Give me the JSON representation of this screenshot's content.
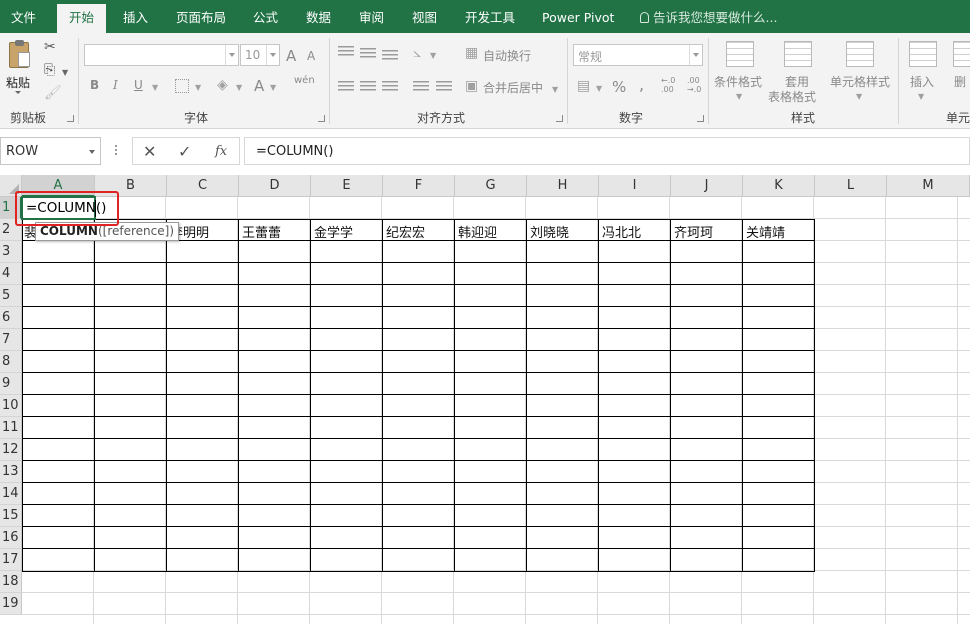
{
  "ribbon_tabs": [
    "文件",
    "开始",
    "插入",
    "页面布局",
    "公式",
    "数据",
    "审阅",
    "视图",
    "开发工具",
    "Power Pivot"
  ],
  "tell_me": "告诉我您想要做什么...",
  "clipboard": {
    "paste": "粘贴",
    "label": "剪贴板"
  },
  "font": {
    "size": "10",
    "label": "字体",
    "bold": "B",
    "italic": "I",
    "underline": "U",
    "grow": "A",
    "shrink": "A",
    "color": "A",
    "phonetic": "wén"
  },
  "alignment": {
    "wrap": "自动换行",
    "merge": "合并后居中",
    "label": "对齐方式"
  },
  "number": {
    "format": "常规",
    "percent": "%",
    "comma": ",",
    "inc": "←.0 .00",
    "dec": ".00 →.0",
    "label": "数字"
  },
  "styles": {
    "cond": "条件格式",
    "table_l1": "套用",
    "table_l2": "表格格式",
    "cell": "单元格样式",
    "label": "样式"
  },
  "cells_group": {
    "insert": "插入",
    "delete": "删",
    "label": "单元"
  },
  "name_box": "ROW",
  "formula": "=COLUMN()",
  "columns": [
    "A",
    "B",
    "C",
    "D",
    "E",
    "F",
    "G",
    "H",
    "I",
    "J",
    "K",
    "L",
    "M"
  ],
  "rows": [
    "1",
    "2",
    "3",
    "4",
    "5",
    "6",
    "7",
    "8",
    "9",
    "10",
    "11",
    "12",
    "13",
    "14",
    "15",
    "16",
    "17",
    "18",
    "19"
  ],
  "cell_a1": "=COLUMN()",
  "a2_fragment": "裴",
  "names": [
    "李明明",
    "王蕾蕾",
    "金学学",
    "纪宏宏",
    "韩迎迎",
    "刘晓晓",
    "冯北北",
    "齐珂珂",
    "关靖靖"
  ],
  "tooltip": {
    "fn": "COLUMN",
    "arg": "([reference])"
  }
}
